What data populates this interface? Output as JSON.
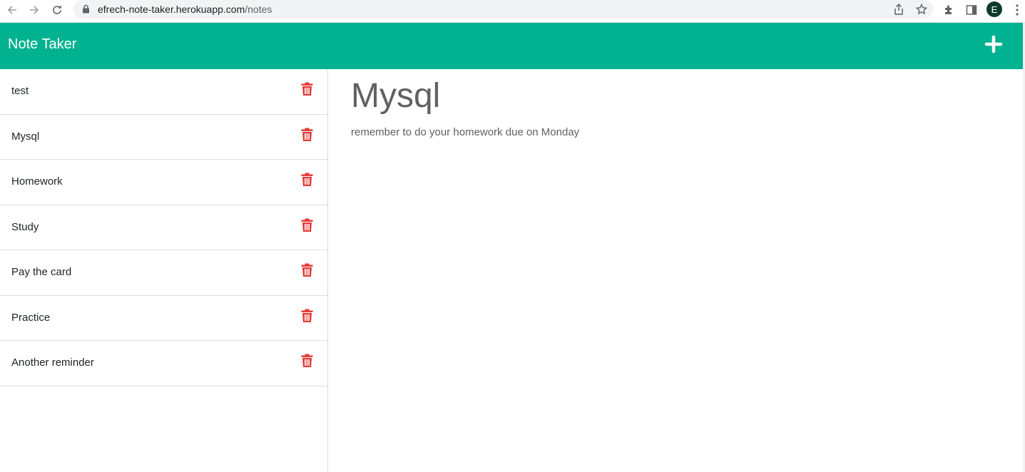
{
  "browser": {
    "url_domain": "efrech-note-taker.herokuapp.com",
    "url_path": "/notes",
    "avatar_letter": "E"
  },
  "header": {
    "title": "Note Taker",
    "add_icon": "plus-icon",
    "color": "#00b28f"
  },
  "notes": [
    {
      "title": "test"
    },
    {
      "title": "Mysql"
    },
    {
      "title": "Homework"
    },
    {
      "title": "Study"
    },
    {
      "title": "Pay the card"
    },
    {
      "title": "Practice"
    },
    {
      "title": "Another reminder"
    }
  ],
  "active_note": {
    "title": "Mysql",
    "text": "remember to do your homework due on Monday"
  },
  "colors": {
    "trash": "#e53935",
    "text": "#616161"
  }
}
